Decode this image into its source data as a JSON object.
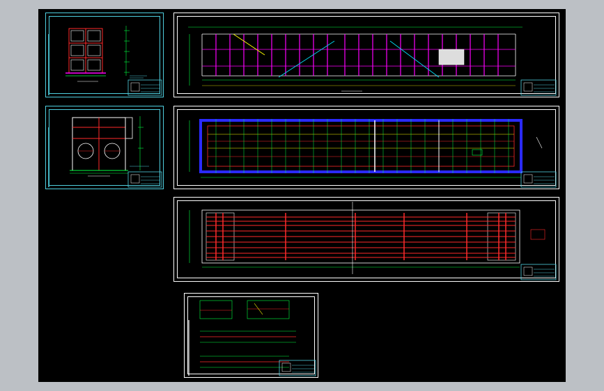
{
  "viewer": {
    "background_color": "#bcc0c5",
    "canvas_color": "#000000"
  },
  "colors": {
    "frame": "#ffffff",
    "teal": "#4fd0e0",
    "red": "#ff2a2a",
    "blue": "#2a2aff",
    "yellow": "#ffff00",
    "green": "#00ff40",
    "magenta": "#ff00ff",
    "cyan": "#00e5ff"
  },
  "sheets": [
    {
      "id": "section-sheet-1",
      "kind": "cross-section"
    },
    {
      "id": "section-sheet-2",
      "kind": "cross-section"
    },
    {
      "id": "elevation-sheet",
      "kind": "longitudinal-section"
    },
    {
      "id": "plan-sheet",
      "kind": "plan-view"
    },
    {
      "id": "rebar-sheet",
      "kind": "reinforcement-plan"
    },
    {
      "id": "detail-sheet",
      "kind": "details"
    }
  ]
}
